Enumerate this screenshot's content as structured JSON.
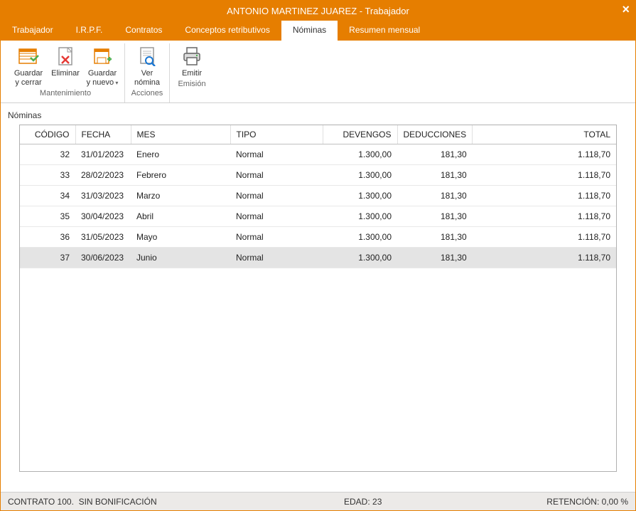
{
  "title": "ANTONIO MARTINEZ JUAREZ - Trabajador",
  "menu": {
    "items": [
      {
        "label": "Trabajador",
        "active": false
      },
      {
        "label": "I.R.P.F.",
        "active": false
      },
      {
        "label": "Contratos",
        "active": false
      },
      {
        "label": "Conceptos retributivos",
        "active": false
      },
      {
        "label": "Nóminas",
        "active": true
      },
      {
        "label": "Resumen mensual",
        "active": false
      }
    ]
  },
  "ribbon": {
    "groups": [
      {
        "label": "Mantenimiento",
        "buttons": [
          {
            "id": "save-close",
            "line1": "Guardar",
            "line2": "y cerrar",
            "icon": "save-close"
          },
          {
            "id": "delete",
            "line1": "Eliminar",
            "line2": "",
            "icon": "delete"
          },
          {
            "id": "save-new",
            "line1": "Guardar",
            "line2": "y nuevo",
            "icon": "save-new",
            "dropdown": true
          }
        ]
      },
      {
        "label": "Acciones",
        "buttons": [
          {
            "id": "view-payroll",
            "line1": "Ver",
            "line2": "nómina",
            "icon": "view"
          }
        ]
      },
      {
        "label": "Emisión",
        "buttons": [
          {
            "id": "emit",
            "line1": "Emitir",
            "line2": "",
            "icon": "print"
          }
        ]
      }
    ]
  },
  "section_title": "Nóminas",
  "table": {
    "headers": {
      "codigo": "CÓDIGO",
      "fecha": "FECHA",
      "mes": "MES",
      "tipo": "TIPO",
      "devengos": "DEVENGOS",
      "deducciones": "DEDUCCIONES",
      "total": "TOTAL"
    },
    "rows": [
      {
        "codigo": "32",
        "fecha": "31/01/2023",
        "mes": "Enero",
        "tipo": "Normal",
        "devengos": "1.300,00",
        "deducciones": "181,30",
        "total": "1.118,70",
        "selected": false
      },
      {
        "codigo": "33",
        "fecha": "28/02/2023",
        "mes": "Febrero",
        "tipo": "Normal",
        "devengos": "1.300,00",
        "deducciones": "181,30",
        "total": "1.118,70",
        "selected": false
      },
      {
        "codigo": "34",
        "fecha": "31/03/2023",
        "mes": "Marzo",
        "tipo": "Normal",
        "devengos": "1.300,00",
        "deducciones": "181,30",
        "total": "1.118,70",
        "selected": false
      },
      {
        "codigo": "35",
        "fecha": "30/04/2023",
        "mes": "Abril",
        "tipo": "Normal",
        "devengos": "1.300,00",
        "deducciones": "181,30",
        "total": "1.118,70",
        "selected": false
      },
      {
        "codigo": "36",
        "fecha": "31/05/2023",
        "mes": "Mayo",
        "tipo": "Normal",
        "devengos": "1.300,00",
        "deducciones": "181,30",
        "total": "1.118,70",
        "selected": false
      },
      {
        "codigo": "37",
        "fecha": "30/06/2023",
        "mes": "Junio",
        "tipo": "Normal",
        "devengos": "1.300,00",
        "deducciones": "181,30",
        "total": "1.118,70",
        "selected": true
      }
    ]
  },
  "status": {
    "left_label": "CONTRATO 100.",
    "left_value": "SIN BONIFICACIÓN",
    "mid_label": "EDAD:",
    "mid_value": "23",
    "right_label": "RETENCIÓN:",
    "right_value": "0,00 %"
  }
}
